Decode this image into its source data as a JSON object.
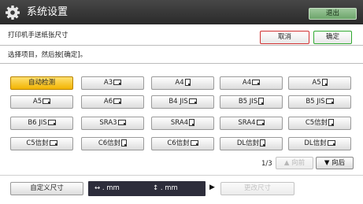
{
  "header": {
    "title": "系统设置",
    "exit_label": "退出",
    "icon": "gear-icon"
  },
  "page": {
    "title": "打印机手送纸张尺寸",
    "cancel_label": "取消",
    "ok_label": "确定",
    "instruction": "选择项目，然后按[确定]。"
  },
  "sizes": [
    {
      "label": "自动检测",
      "orientation": "",
      "selected": true
    },
    {
      "label": "A3",
      "orientation": "landscape",
      "selected": false
    },
    {
      "label": "A4",
      "orientation": "portrait",
      "selected": false
    },
    {
      "label": "A4",
      "orientation": "landscape",
      "selected": false
    },
    {
      "label": "A5",
      "orientation": "portrait",
      "selected": false
    },
    {
      "label": "A5",
      "orientation": "landscape",
      "selected": false
    },
    {
      "label": "A6",
      "orientation": "landscape",
      "selected": false
    },
    {
      "label": "B4 JIS",
      "orientation": "landscape",
      "selected": false
    },
    {
      "label": "B5 JIS",
      "orientation": "portrait",
      "selected": false
    },
    {
      "label": "B5 JIS",
      "orientation": "landscape",
      "selected": false
    },
    {
      "label": "B6 JIS",
      "orientation": "landscape",
      "selected": false
    },
    {
      "label": "SRA3",
      "orientation": "landscape",
      "selected": false
    },
    {
      "label": "SRA4",
      "orientation": "portrait",
      "selected": false
    },
    {
      "label": "SRA4",
      "orientation": "landscape",
      "selected": false
    },
    {
      "label": "C5信封",
      "orientation": "portrait",
      "selected": false
    },
    {
      "label": "C5信封",
      "orientation": "landscape",
      "selected": false
    },
    {
      "label": "C6信封",
      "orientation": "portrait",
      "selected": false
    },
    {
      "label": "C6信封",
      "orientation": "landscape",
      "selected": false
    },
    {
      "label": "DL信封",
      "orientation": "portrait",
      "selected": false
    },
    {
      "label": "DL信封",
      "orientation": "landscape",
      "selected": false
    }
  ],
  "pagination": {
    "indicator": "1/3",
    "prev_label": "▲ 向前",
    "next_label": "▼ 向后",
    "prev_enabled": false
  },
  "custom": {
    "button_label": "自定义尺寸",
    "width_display": "↔  . mm",
    "height_display": "↕  . mm",
    "change_label": "更改尺寸",
    "change_enabled": false
  },
  "colors": {
    "header_bg": "#333333",
    "selected_bg": "#f5c21b",
    "cancel_border": "#d03030",
    "ok_border": "#2fa82f",
    "exit_bg": "#8fbf8d"
  }
}
